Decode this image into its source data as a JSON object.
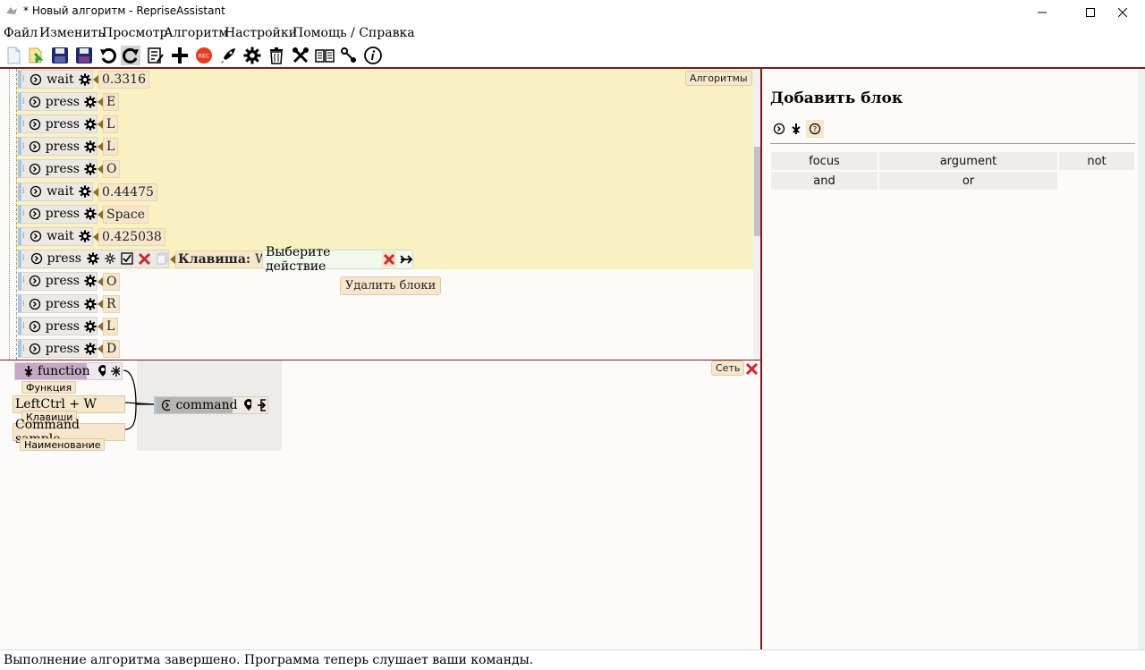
{
  "window": {
    "title": "* Новый алгоритм - RepriseAssistant"
  },
  "menu": [
    "Файл",
    "Изменить",
    "Просмотр",
    "Алгоритм",
    "Настройки",
    "Помощь / Справка"
  ],
  "toolbar_icons": [
    "new-file-icon",
    "open-file-icon",
    "save-icon",
    "save-as-icon",
    "undo-icon",
    "redo-icon",
    "edit-list-icon",
    "add-icon",
    "record-icon",
    "run-icon",
    "settings-icon",
    "delete-icon",
    "tools-icon",
    "book-icon",
    "connect-icon",
    "info-icon"
  ],
  "record_label": "REC",
  "algorithm": {
    "tag": "Алгоритмы",
    "rows": [
      {
        "name": "wait",
        "arg": "0.3316"
      },
      {
        "name": "press",
        "arg": "E"
      },
      {
        "name": "press",
        "arg": "L"
      },
      {
        "name": "press",
        "arg": "L"
      },
      {
        "name": "press",
        "arg": "O"
      },
      {
        "name": "wait",
        "arg": "0.44475"
      },
      {
        "name": "press",
        "arg": "Space"
      },
      {
        "name": "wait",
        "arg": "0.425038"
      },
      {
        "name": "press",
        "arg": ""
      },
      {
        "name": "press",
        "arg": "O"
      },
      {
        "name": "press",
        "arg": "R"
      },
      {
        "name": "press",
        "arg": "L"
      },
      {
        "name": "press",
        "arg": "D"
      }
    ],
    "selected": {
      "key_label": "Клавиша:",
      "key_value": "W",
      "action_placeholder": "Выберите действие"
    },
    "tooltip": "Удалить блоки"
  },
  "network": {
    "tag": "Сеть",
    "function_label": "function",
    "function_sublabel": "Функция",
    "keys_value": "LeftCtrl + W",
    "keys_sublabel": "Клавиши",
    "name_value": "Command sample",
    "name_sublabel": "Наименование",
    "command_label": "command"
  },
  "add_block": {
    "title": "Добавить блок",
    "grid": [
      [
        "focus",
        "argument",
        "not"
      ],
      [
        "and",
        "or"
      ]
    ]
  },
  "status": "Выполнение алгоритма завершено. Программа теперь слушает ваши команды."
}
